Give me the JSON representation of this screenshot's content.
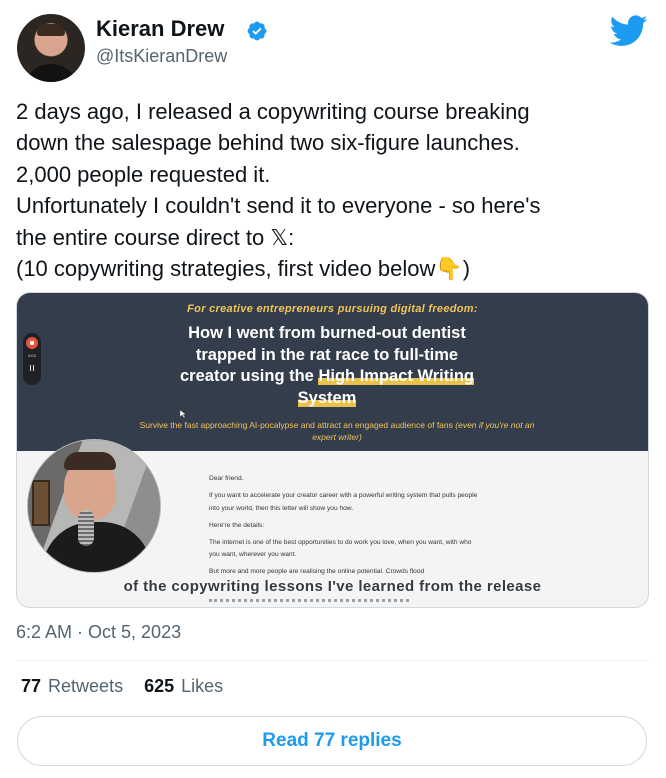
{
  "author": {
    "name": "Kieran Drew",
    "handle": "@ItsKieranDrew",
    "verified_icon": "verified-badge-icon",
    "brand_color": "#1d9bf0"
  },
  "tweet": {
    "lines": [
      "2 days ago, I released a copywriting course breaking",
      "down the salespage behind two six-figure launches.",
      "2,000 people requested it.",
      "Unfortunately I couldn't send it to everyone - so here's",
      "the entire course direct to 𝕏:",
      "(10 copywriting strategies, first video below👇)"
    ]
  },
  "media": {
    "eyebrow": "For creative entrepreneurs pursuing digital freedom:",
    "headline_lines": [
      "How I went from burned-out dentist",
      "trapped in the rat race to full-time",
      "creator using the "
    ],
    "headline_highlight_1": "High Impact Writing",
    "headline_highlight_2": "System",
    "subheadline": "Survive the fast approaching AI-pocalypse and attract an engaged audience of fans ",
    "subheadline_italic": "(even if you're not an expert writer)",
    "recorder_time": "0:03",
    "letter": [
      "Dear friend.",
      "If you want to accelerate your creator career with a powerful writing system that pulls people into your world, then this letter will show you how.",
      "Here're the details:",
      "The internet is one of the best opportunities to do work you love, when you want, with who you want, wherever you want.",
      "But more and more people are realising the online potential. Crowds flood"
    ],
    "caption": "of the copywriting lessons I've learned from the release"
  },
  "meta": {
    "timestamp": "6:2 AM · Oct 5, 2023",
    "retweets_count": "77",
    "retweets_label": "Retweets",
    "likes_count": "625",
    "likes_label": "Likes"
  },
  "actions": {
    "replies_button": "Read 77 replies"
  }
}
